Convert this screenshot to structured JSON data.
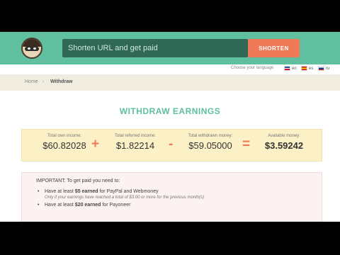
{
  "header": {
    "search_placeholder": "Shorten URL and get paid",
    "shorten_label": "SHORTEN"
  },
  "langbar": {
    "choose_label": "Choose your language",
    "languages": [
      {
        "code": "en",
        "label": "en"
      },
      {
        "code": "es",
        "label": "es"
      },
      {
        "code": "ru",
        "label": "ru"
      }
    ]
  },
  "breadcrumb": {
    "home": "Home",
    "separator": "›",
    "current": "Withdraw"
  },
  "title": "WITHDRAW EARNINGS",
  "stats": [
    {
      "label": "Total own income:",
      "value": "$60.82028"
    },
    {
      "label": "Total referred income:",
      "value": "$1.82214"
    },
    {
      "label": "Total withdrawn money:",
      "value": "$59.05000"
    },
    {
      "label": "Available money:",
      "value": "$3.59242"
    }
  ],
  "operators": [
    "+",
    "-",
    "="
  ],
  "info": {
    "important": "IMPORTANT: To get paid you need to:",
    "item1_pre": "Have at least ",
    "item1_amount": "$5 earned",
    "item1_post": " for PayPal and Webmoney",
    "item1_note": "Only if your earnings have reached a total of $3.00 or more for the previous month(s)",
    "item2_pre": "Have at least ",
    "item2_amount": "$20 earned",
    "item2_post": " for Payoneer"
  },
  "colors": {
    "header": "#5fbf9f",
    "accent": "#ee7a58",
    "search_bg": "#2f6955",
    "stats_bg": "#fcf0c6"
  }
}
